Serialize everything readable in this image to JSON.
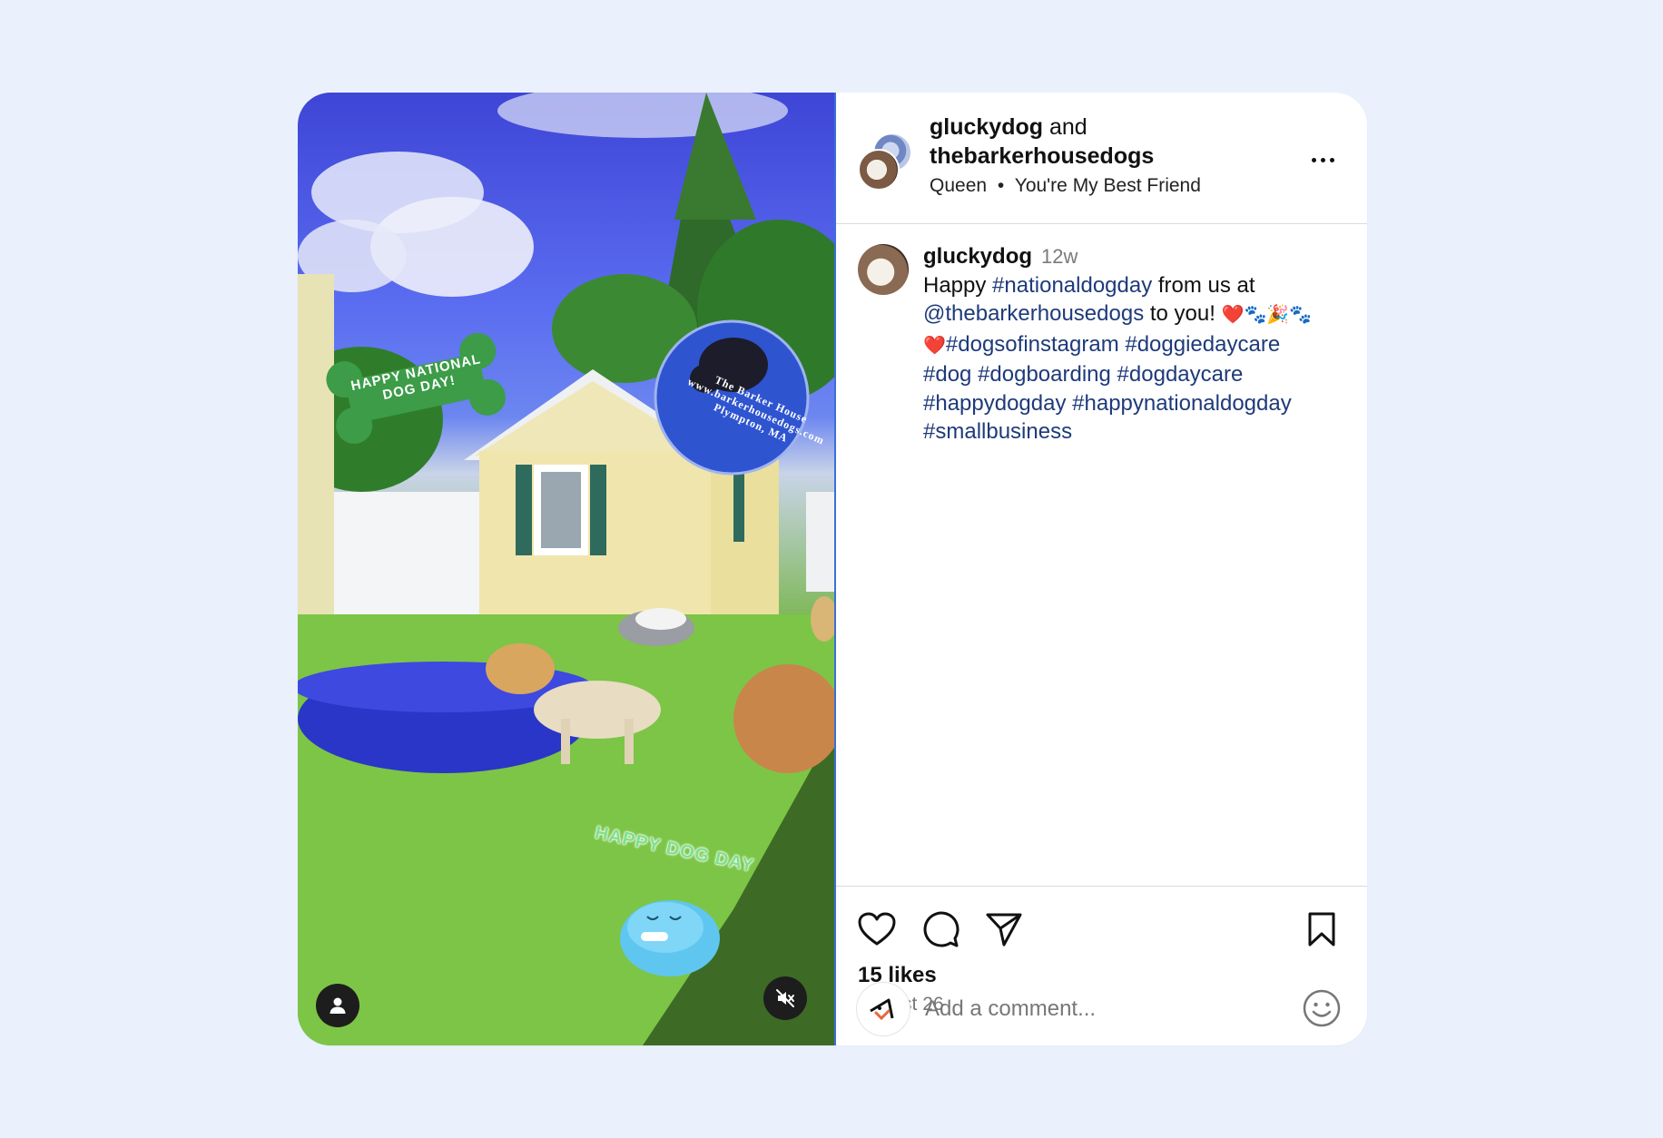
{
  "post": {
    "header": {
      "author1": "gluckydog",
      "joiner": "and",
      "author2": "thebarkerhousedogs",
      "audio_artist": "Queen",
      "audio_separator": "•",
      "audio_title": "You're My Best Friend",
      "more_icon": "more-horizontal-icon"
    },
    "media": {
      "sticker_bone": "HAPPY NATIONAL DOG DAY!",
      "sticker_circle_line1": "The Barker House",
      "sticker_circle_line2": "www.barkerhousedogs.com",
      "sticker_circle_line3": "Plympton, MA",
      "sticker_arc": "HAPPY DOG DAY",
      "user_icon": "person-icon",
      "mute_icon": "speaker-muted-icon"
    },
    "caption": {
      "username": "gluckydog",
      "time": "12w",
      "t1": "Happy ",
      "tag1": "#nationaldogday",
      "t2": " from us at ",
      "mention": "@thebarkerhousedogs",
      "t3": " to you! ",
      "emoji1": "❤️🐾🎉🐾",
      "emoji2": "❤️",
      "tag2": "#dogsofinstagram",
      "tag3": "#doggiedaycare",
      "tag4": "#dog",
      "tag5": "#dogboarding",
      "tag6": "#dogdaycare",
      "tag7": "#happydogday",
      "tag8": "#happynationaldogday",
      "tag9": "#smallbusiness"
    },
    "actions": {
      "likes": "15 likes",
      "date": "August 26",
      "icons": [
        "heart-icon",
        "comment-icon",
        "send-icon",
        "bookmark-icon"
      ]
    },
    "comment": {
      "placeholder": "Add a comment...",
      "emoji_icon": "smiley-icon"
    },
    "colors": {
      "background": "#eaf1fc",
      "link": "#1e3a7a",
      "muted_text": "#777777"
    }
  }
}
